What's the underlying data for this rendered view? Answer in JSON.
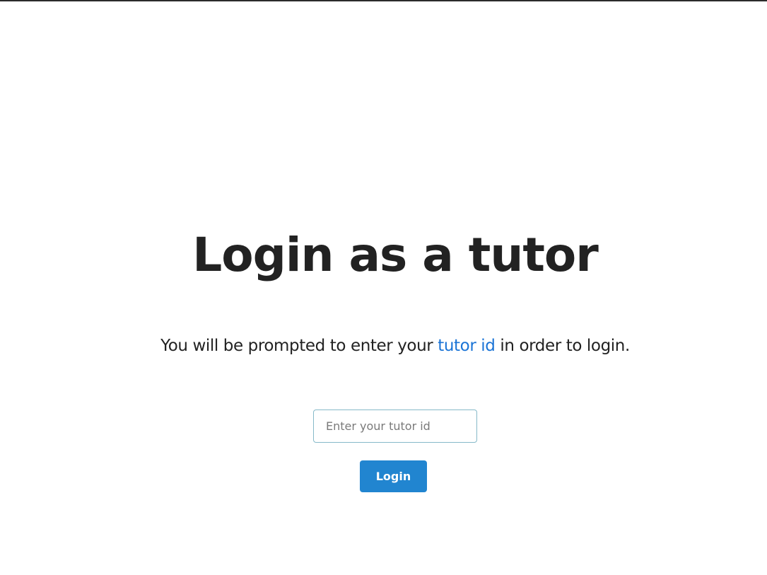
{
  "login": {
    "title": "Login as a tutor",
    "subtitle_before": "You will be prompted to enter your ",
    "subtitle_highlight": "tutor id",
    "subtitle_after": " in order to login.",
    "input_value": "",
    "input_placeholder": "Enter your tutor id",
    "button_label": "Login"
  },
  "colors": {
    "highlight": "#1b74d6",
    "button": "#2185d0",
    "input_border": "#86b9c9",
    "text": "#222222"
  }
}
